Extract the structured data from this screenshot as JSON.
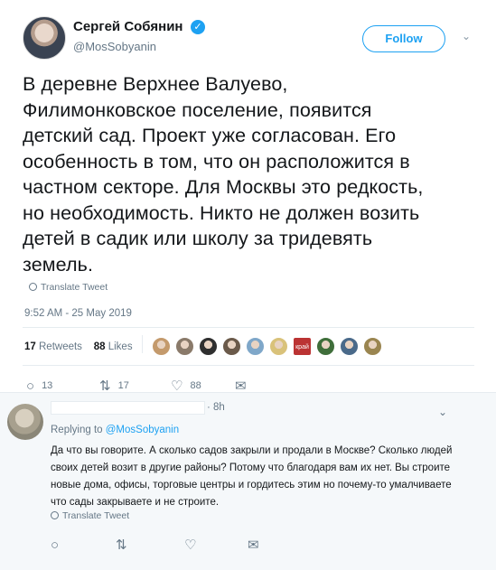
{
  "tweet": {
    "author_name": "Сергей Собянин",
    "author_handle": "@MosSobyanin",
    "follow_label": "Follow",
    "text": "В деревне Верхнее Валуево,\nФилимонковское поселение, появится\nдетский сад. Проект уже согласован. Его\nособенность в том, что он расположится в\nчастном секторе. Для Москвы это редкость,\nно необходимость. Никто не должен возить\nдетей в садик или школу за тридевять\nземель.",
    "translate_label": "Translate Tweet",
    "timestamp": "9:52 AM - 25 May 2019",
    "retweets_count": "17",
    "retweets_label": "Retweets",
    "likes_count": "88",
    "likes_label": "Likes",
    "liker_avatars": [
      "#c49a6c",
      "#8a7a6a",
      "#2f2f2f",
      "#6b5a4a",
      "#7fa7c9",
      "#d9c27a",
      "#bb3333",
      "#3f6e3a",
      "#4a6a8a",
      "#9a8550"
    ],
    "liker_tag": "край",
    "reply_count": "13",
    "retweet_count_action": "17",
    "like_count_action": "88"
  },
  "reply": {
    "time": "· 8h",
    "replying_prefix": "Replying to",
    "replying_handle": "@MosSobyanin",
    "text": "Да что вы говорите. А сколько садов закрыли и продали в Москве? Сколько людей своих детей возит в другие районы? Потому что благодаря вам их нет. Вы строите новые дома, офисы, торговые центры и гордитесь этим но почему-то умалчиваете что сады закрываете и не строите.",
    "translate_label": "Translate Tweet"
  },
  "icons": {
    "verified": "✓",
    "caret": "⌄",
    "reply": "○",
    "retweet": "⇅",
    "like": "♡",
    "message": "✉"
  },
  "colors": {
    "accent": "#1da1f2",
    "muted": "#657786",
    "reply_bg": "#f5f8fa"
  }
}
